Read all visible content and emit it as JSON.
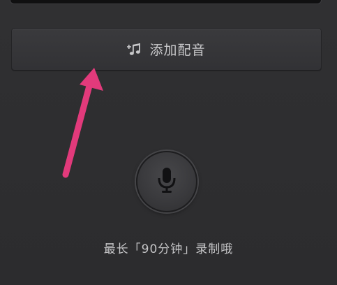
{
  "dub_panel": {
    "add_dub_label": "添加配音",
    "add_dub_icon": "music-note-add-icon",
    "mic_icon": "microphone-icon",
    "hint": "最长「90分钟」录制哦"
  },
  "annotation": {
    "arrow_color": "#e23a7b"
  }
}
